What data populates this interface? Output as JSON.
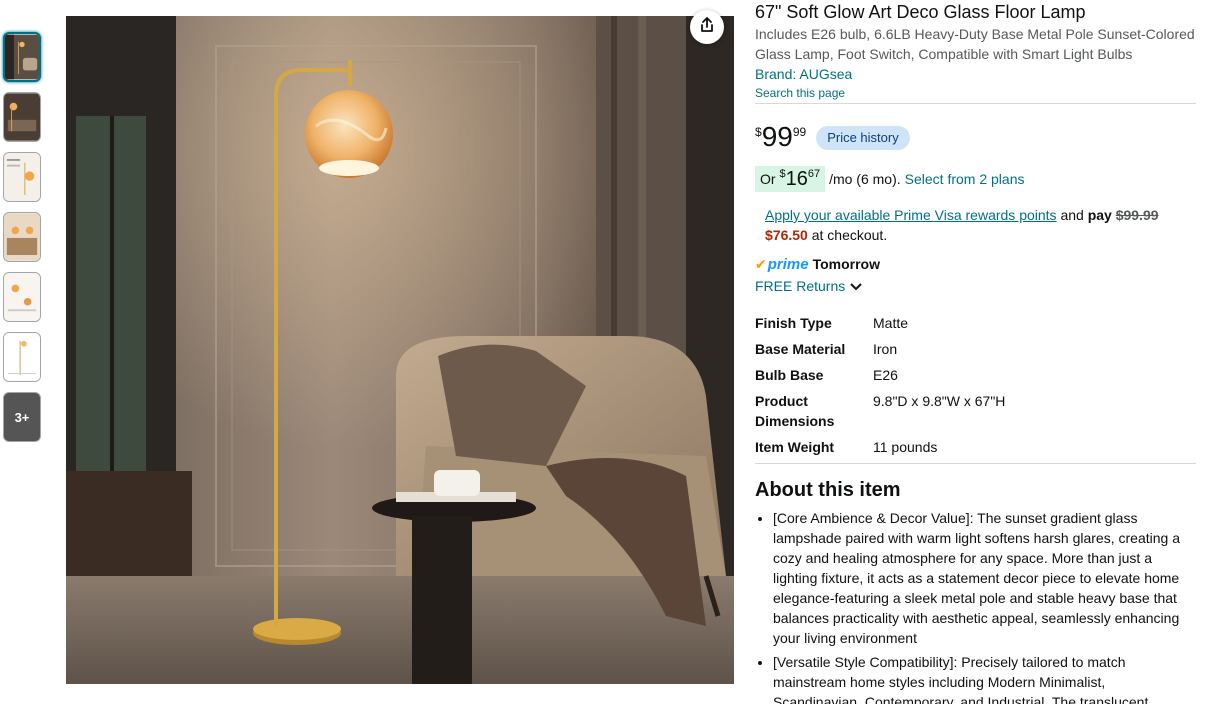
{
  "thumbnails": {
    "more_label": "3+"
  },
  "product": {
    "title": "67\" Soft Glow Art Deco Glass Floor Lamp",
    "subtitle": "Includes E26 bulb, 6.6LB Heavy-Duty Base Metal Pole Sunset-Colored Glass Lamp, Foot Switch, Compatible with Smart Light Bulbs",
    "brand": "Brand: AUGsea",
    "search_page": "Search this page"
  },
  "price": {
    "symbol": "$",
    "whole": "99",
    "fraction": "99",
    "history_label": "Price history"
  },
  "installment": {
    "prefix": "Or",
    "symbol": "$",
    "whole": "16",
    "fraction": "67",
    "suffix": "/mo (6 mo).",
    "plans_link": "Select from 2 plans"
  },
  "rewards": {
    "link": "Apply your available Prime Visa rewards points",
    "and": "and",
    "pay": "pay",
    "old_price": "$99.99",
    "new_price": "$76.50",
    "tail": "at checkout."
  },
  "delivery": {
    "prime_label": "prime",
    "day": "Tomorrow",
    "returns": "FREE Returns"
  },
  "specs": [
    {
      "key": "Finish Type",
      "value": "Matte"
    },
    {
      "key": "Base Material",
      "value": "Iron"
    },
    {
      "key": "Bulb Base",
      "value": "E26"
    },
    {
      "key": "Product Dimensions",
      "value": "9.8\"D x 9.8\"W x 67\"H"
    },
    {
      "key": "Item Weight",
      "value": "11 pounds"
    }
  ],
  "about": {
    "heading": "About this item",
    "bullets": [
      "[Core Ambience & Decor Value]: The sunset gradient glass lampshade paired with warm light softens harsh glares, creating a cozy and healing atmosphere for any space. More than just a lighting fixture, it acts as a statement decor piece to elevate home elegance-featuring a sleek metal pole and stable heavy base that balances practicality with aesthetic appeal, seamlessly enhancing your living environment",
      "[Versatile Style Compatibility]: Precisely tailored to match mainstream home styles including Modern Minimalist, Scandinavian, Contemporary, and Industrial. The translucent"
    ]
  },
  "colors": {
    "link": "#007185",
    "price_red": "#b12704",
    "prime_blue": "#1399ff",
    "badge_bg": "#cfe4f9",
    "installment_bg": "#d7f4e4"
  }
}
